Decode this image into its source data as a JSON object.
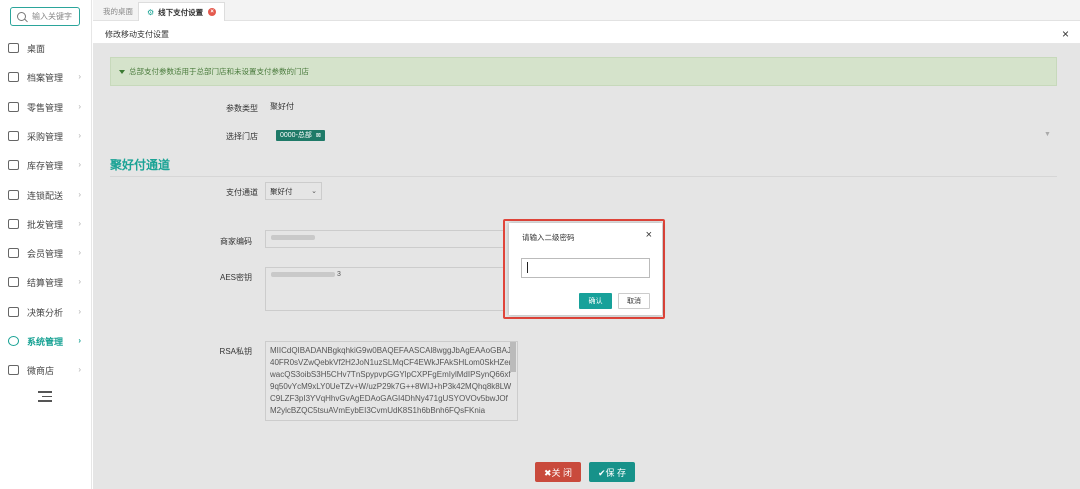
{
  "sidebar": {
    "search_placeholder": "输入关键字",
    "items": [
      {
        "label": "桌面",
        "icon": "monitor-icon",
        "has_chevron": false
      },
      {
        "label": "档案管理",
        "icon": "archive-icon",
        "has_chevron": true
      },
      {
        "label": "零售管理",
        "icon": "store-icon",
        "has_chevron": true
      },
      {
        "label": "采购管理",
        "icon": "purchase-icon",
        "has_chevron": true
      },
      {
        "label": "库存管理",
        "icon": "inventory-icon",
        "has_chevron": true
      },
      {
        "label": "连锁配送",
        "icon": "delivery-icon",
        "has_chevron": true
      },
      {
        "label": "批发管理",
        "icon": "wholesale-icon",
        "has_chevron": true
      },
      {
        "label": "会员管理",
        "icon": "member-icon",
        "has_chevron": true
      },
      {
        "label": "结算管理",
        "icon": "settlement-icon",
        "has_chevron": true
      },
      {
        "label": "决策分析",
        "icon": "analysis-icon",
        "has_chevron": true
      },
      {
        "label": "系统管理",
        "icon": "settings-icon",
        "has_chevron": true,
        "active": true
      },
      {
        "label": "微商店",
        "icon": "wechat-shop-icon",
        "has_chevron": true
      }
    ],
    "chevron": "›"
  },
  "tabs": {
    "home": "我的桌面",
    "current": "线下支付设置",
    "current_close": "×",
    "gear": "⚙"
  },
  "panel": {
    "title": "修改移动支付设置",
    "close": "×"
  },
  "form": {
    "notice": "总部支付参数适用于总部门店和未设置支付参数的门店",
    "param_type_label": "参数类型",
    "param_type_value": "聚好付",
    "store_label": "选择门店",
    "store_tag": "0000-总部",
    "store_tag_x": "⊠",
    "section_title": "聚好付通道",
    "channel_label": "支付通道",
    "channel_value": "聚好付",
    "merchant_label": "商家编码",
    "aes_label": "AES密钥",
    "aes_tail": "3",
    "rsa_label": "RSA私钥",
    "rsa_text": "MIICdQIBADANBgkqhkiG9w0BAQEFAASCAl8wggJbAgEAAoGBAJ40FR0sVZwQebkVf2H2JoN1uzSLMqCF4EWkJFAkSHLom0SkHZerwacQS3oibS3H5CHv7TnSpypvpGGYlpCXPFgEmIylMdIPSynQ66xf9q50vYcM9xLY0UeTZv+W/uzP29k7G++8WIJ+hP3k42MQhq8k8LWC9LZF3pI3YVqHhvGvAgEDAoGAGI4DhNy471gUSYOVOv5bwJOfM2ylcBZQC5tsuAVmEybEI3CvmUdK8S1h6bBnh6FQsFKnia"
  },
  "buttons": {
    "close": "✖关 闭",
    "save": "✔保 存"
  },
  "modal": {
    "title": "请输入二级密码",
    "close": "×",
    "input_value": "",
    "ok": "确认",
    "cancel": "取消"
  },
  "colors": {
    "accent": "#1aa395",
    "highlight": "#e0453a",
    "close_button": "#c94a3c",
    "save_button": "#17928a"
  }
}
